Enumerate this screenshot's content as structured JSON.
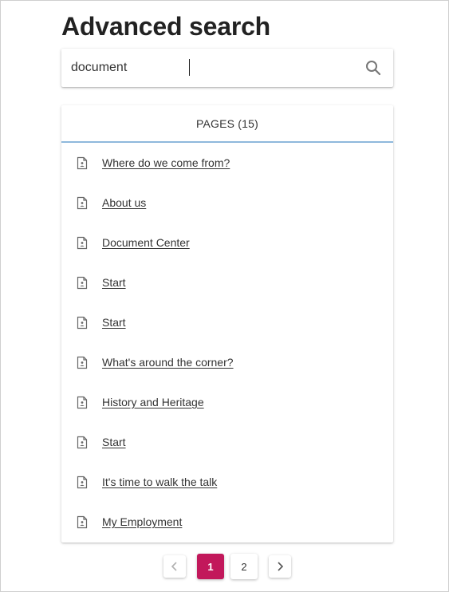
{
  "page": {
    "title": "Advanced search"
  },
  "search": {
    "value": "document",
    "icon": "search-icon"
  },
  "tabs": {
    "pages_label": "PAGES (15)"
  },
  "colors": {
    "accent": "#c2185b",
    "tab_underline": "#8fb9dc"
  },
  "results": [
    {
      "title": "Where do we come from?",
      "icon": "document-icon"
    },
    {
      "title": "About us",
      "icon": "document-icon"
    },
    {
      "title": "Document Center",
      "icon": "document-icon"
    },
    {
      "title": "Start",
      "icon": "document-icon"
    },
    {
      "title": "Start",
      "icon": "document-icon"
    },
    {
      "title": "What's around the corner?",
      "icon": "document-icon"
    },
    {
      "title": "History and Heritage",
      "icon": "document-icon"
    },
    {
      "title": "Start",
      "icon": "document-icon"
    },
    {
      "title": "It's time to walk the talk",
      "icon": "document-icon"
    },
    {
      "title": "My Employment",
      "icon": "document-icon"
    }
  ],
  "pagination": {
    "current": "1",
    "pages": [
      "1",
      "2"
    ],
    "prev_icon": "chevron-left-icon",
    "next_icon": "chevron-right-icon"
  }
}
